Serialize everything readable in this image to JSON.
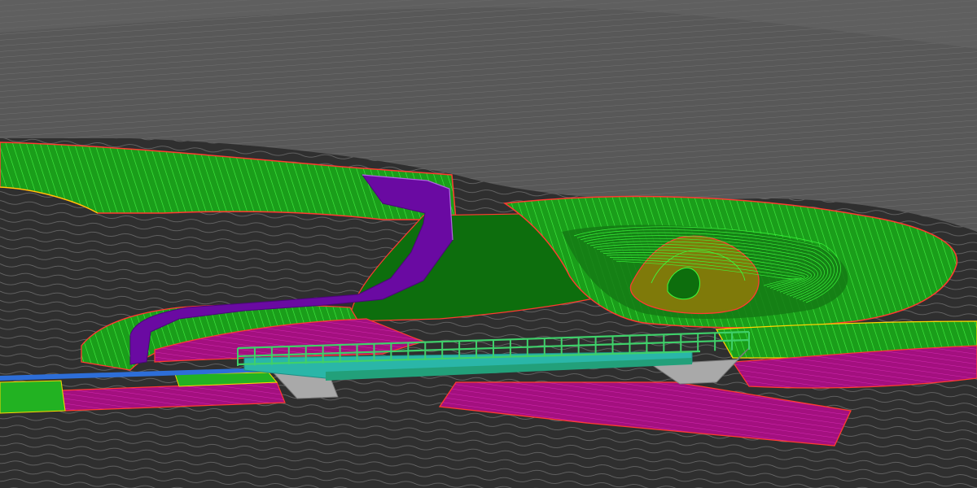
{
  "scene": {
    "description_visible_text": "",
    "colors": {
      "background": "#2e2e2e",
      "upper_terrain": "#5a5a5a",
      "contour_gray": "#8a8a8a",
      "grass_green": "#22b222",
      "dark_green": "#0b6d0b",
      "contour_bright_green": "#3cff3c",
      "boundary_red": "#ff3b30",
      "boundary_yellow": "#ffd400",
      "olive": "#7f7a0a",
      "magenta": "#b0108a",
      "purple_wall": "#6a0aa2",
      "bridge_green": "#3fd06a",
      "bridge_teal": "#2ab6a8",
      "abutment_gray": "#a9a9a9",
      "water_blue": "#2d6ed8"
    },
    "objects": [
      "terrain-surface",
      "graded-green-areas",
      "detention-pond",
      "retaining-wall",
      "pedestrian-bridge",
      "bridge-abutments",
      "paved-areas",
      "stream-channel"
    ]
  }
}
